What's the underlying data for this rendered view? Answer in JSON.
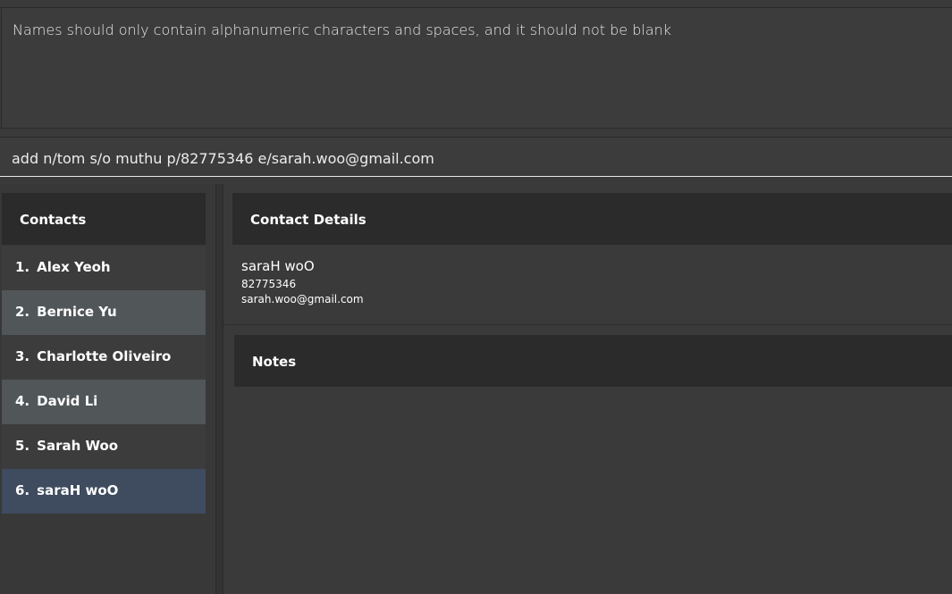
{
  "result": {
    "message": "Names should only contain alphanumeric characters and spaces, and it should not be blank"
  },
  "command": {
    "value": "add n/tom s/o muthu p/82775346 e/sarah.woo@gmail.com"
  },
  "contacts": {
    "header": "Contacts",
    "items": [
      {
        "index": "1.",
        "name": "Alex Yeoh"
      },
      {
        "index": "2.",
        "name": "Bernice Yu"
      },
      {
        "index": "3.",
        "name": "Charlotte Oliveiro"
      },
      {
        "index": "4.",
        "name": "David Li"
      },
      {
        "index": "5.",
        "name": "Sarah Woo"
      },
      {
        "index": "6.",
        "name": "saraH woO"
      }
    ],
    "selected_index": 6
  },
  "details": {
    "header": "Contact Details",
    "name": "saraH woO",
    "phone": "82775346",
    "email": "sarah.woo@gmail.com"
  },
  "notes": {
    "header": "Notes"
  },
  "colors": {
    "background": "#3a3a3a",
    "header_background": "#2b2b2b",
    "row_light": "#515658",
    "row_dark": "#3c3c3c",
    "row_selected": "#3f4b5e",
    "text": "#ffffff"
  }
}
